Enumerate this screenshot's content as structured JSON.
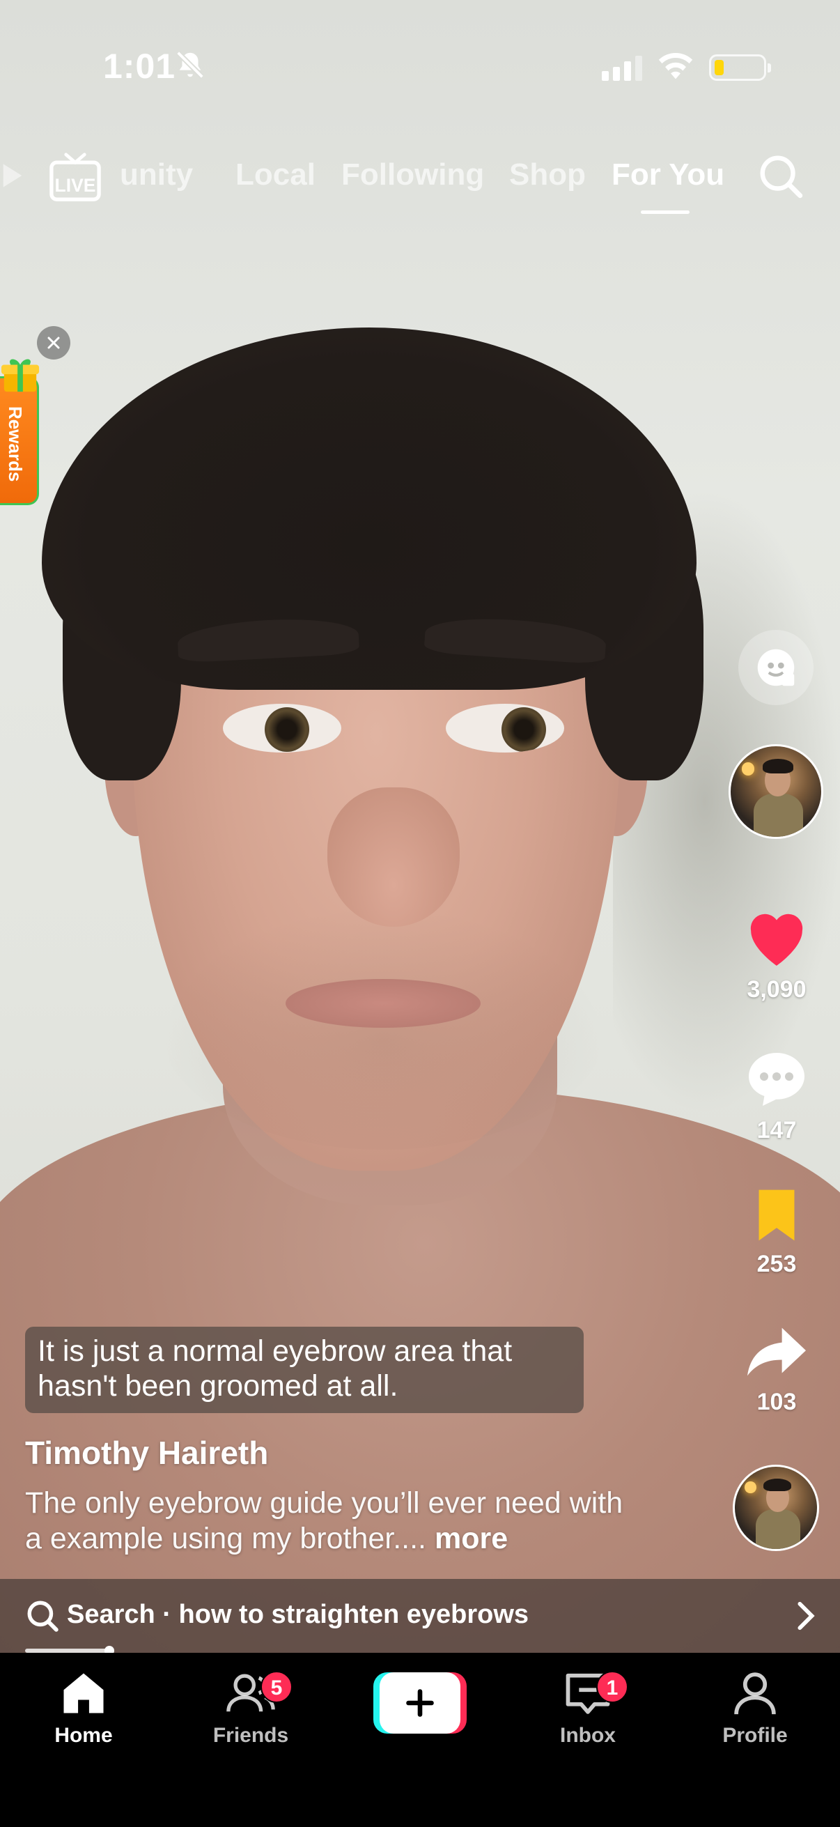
{
  "status_bar": {
    "time": "1:01",
    "battery_level": 0.2
  },
  "top_tabs": {
    "items": [
      {
        "label": "unity"
      },
      {
        "label": "Local"
      },
      {
        "label": "Following"
      },
      {
        "label": "Shop"
      },
      {
        "label": "For You"
      }
    ],
    "active": "For You",
    "live_label": "LIVE"
  },
  "rewards": {
    "label": "Rewards"
  },
  "right_rail": {
    "likes": "3,090",
    "comments": "147",
    "bookmarks": "253",
    "shares": "103"
  },
  "video": {
    "caption_overlay": "It is just a normal eyebrow area that hasn't been groomed at all.",
    "author": "Timothy Haireth",
    "description": "The only eyebrow guide you’ll ever need with a example using my brother....",
    "more_label": "more"
  },
  "search_suggestion": {
    "text": "Search · how to straighten eyebrows"
  },
  "bottom_nav": {
    "home": "Home",
    "friends": "Friends",
    "friends_badge": "5",
    "inbox": "Inbox",
    "inbox_badge": "1",
    "profile": "Profile"
  },
  "colors": {
    "like": "#fe2c55",
    "bookmark": "#fcc419",
    "badge": "#fe2c55",
    "create_cyan": "#25f4ee",
    "create_red": "#fe2c55"
  }
}
